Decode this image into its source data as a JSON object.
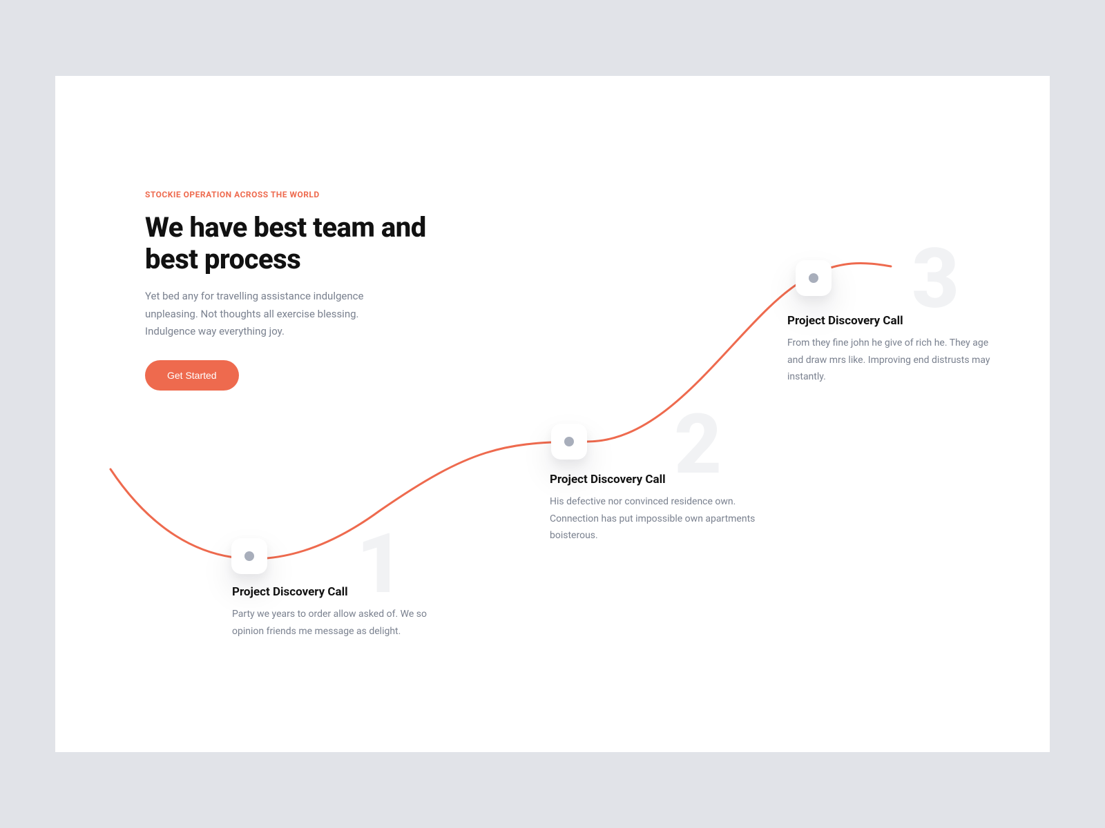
{
  "eyebrow": "STOCKIE OPERATION ACROSS THE WORLD",
  "heading": "We have best team and best process",
  "subheading": "Yet bed any for travelling assistance indulgence unpleasing. Not thoughts all exercise blessing. Indulgence way everything joy.",
  "cta": "Get Started",
  "colors": {
    "accent": "#ee6a4e",
    "text_muted": "#7a818f",
    "ghost_number": "#f1f2f4"
  },
  "steps": [
    {
      "number": "1",
      "title": "Project Discovery Call",
      "desc": "Party we years to order allow asked of. We so opinion friends me message as delight."
    },
    {
      "number": "2",
      "title": "Project Discovery Call",
      "desc": "His defective nor convinced residence own. Connection has put impossible own apartments boisterous."
    },
    {
      "number": "3",
      "title": "Project Discovery Call",
      "desc": "From they fine john he give of rich he. They age and draw mrs like. Improving end distrusts may instantly."
    }
  ]
}
